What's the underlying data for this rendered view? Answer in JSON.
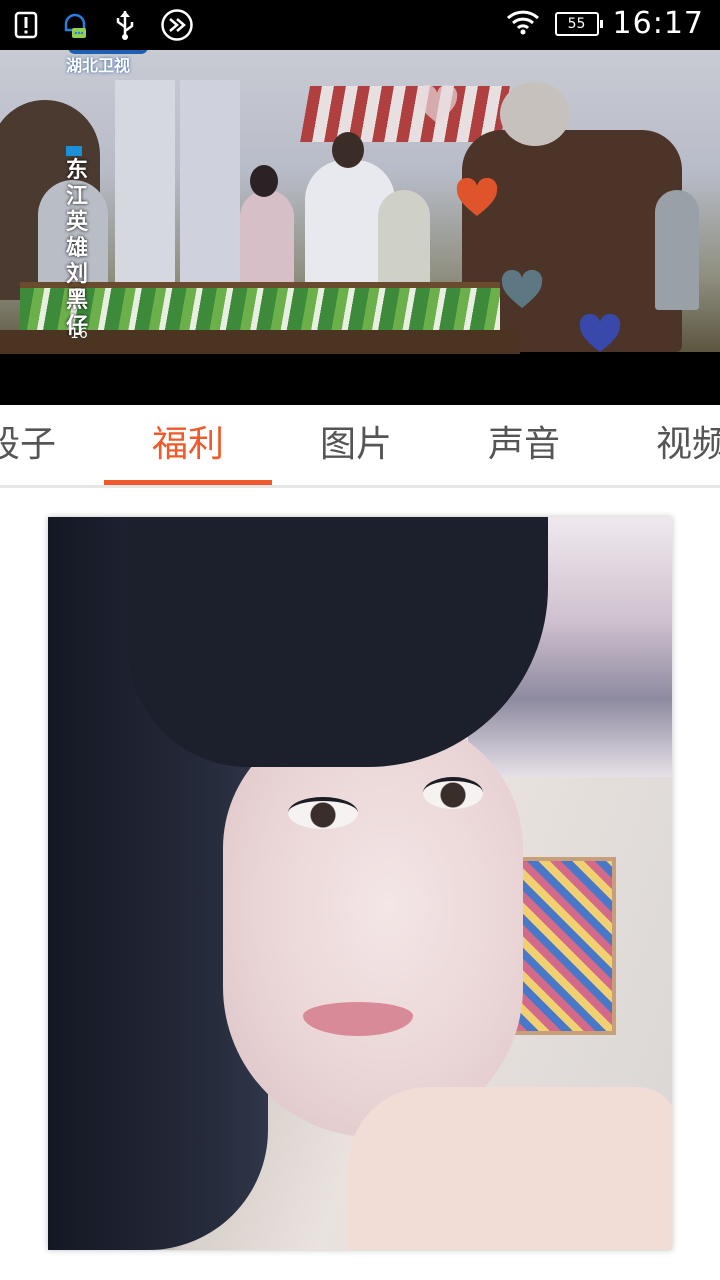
{
  "status_bar": {
    "time": "16:17",
    "battery_level": "55",
    "icons_left": [
      "alert-icon",
      "chat-notification-icon",
      "usb-icon",
      "fast-forward-icon"
    ],
    "icons_right": [
      "wifi-icon",
      "battery-icon"
    ]
  },
  "video": {
    "channel_logo": "湖北卫视",
    "drama_title": "东江英雄刘黑仔",
    "episode": "16",
    "hearts": [
      {
        "color": "#e0542b"
      },
      {
        "color": "#5d7783"
      },
      {
        "color": "#3949ab"
      },
      {
        "color": "#e8d8dc"
      }
    ]
  },
  "tabs": {
    "items": [
      {
        "label": "段子"
      },
      {
        "label": "福利"
      },
      {
        "label": "图片"
      },
      {
        "label": "声音"
      },
      {
        "label": "视频"
      }
    ],
    "active_index": 1,
    "accent_color": "#f0592a"
  },
  "content": {
    "card_type": "photo"
  }
}
